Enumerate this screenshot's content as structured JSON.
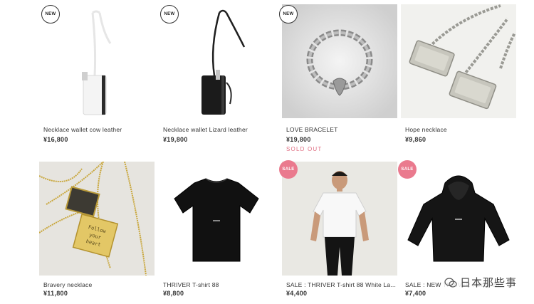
{
  "products": [
    {
      "name": "Necklace wallet cow leather",
      "price": "¥16,800",
      "badge": "NEW",
      "sold_out": ""
    },
    {
      "name": "Necklace wallet Lizard leather",
      "price": "¥19,800",
      "badge": "NEW",
      "sold_out": ""
    },
    {
      "name": "LOVE BRACELET",
      "price": "¥19,800",
      "badge": "NEW",
      "sold_out": "SOLD OUT"
    },
    {
      "name": "Hope necklace",
      "price": "¥9,860",
      "badge": "",
      "sold_out": ""
    },
    {
      "name": "Bravery necklace",
      "price": "¥11,800",
      "badge": "",
      "sold_out": ""
    },
    {
      "name": "THRIVER T-shirt 88",
      "price": "¥8,800",
      "badge": "",
      "sold_out": ""
    },
    {
      "name": "SALE : THRIVER T-shirt 88 White La...",
      "price": "¥4,400",
      "badge": "SALE",
      "sold_out": ""
    },
    {
      "name": "SALE : NEW THRIVER Hoody 88",
      "price": "¥7,400",
      "badge": "SALE",
      "sold_out": ""
    }
  ],
  "engraving": "Follow your heart",
  "watermark": "日本那些事",
  "colors": {
    "sale_badge": "#ea7a8e",
    "sold_out": "#e06f83",
    "text": "#333333"
  }
}
